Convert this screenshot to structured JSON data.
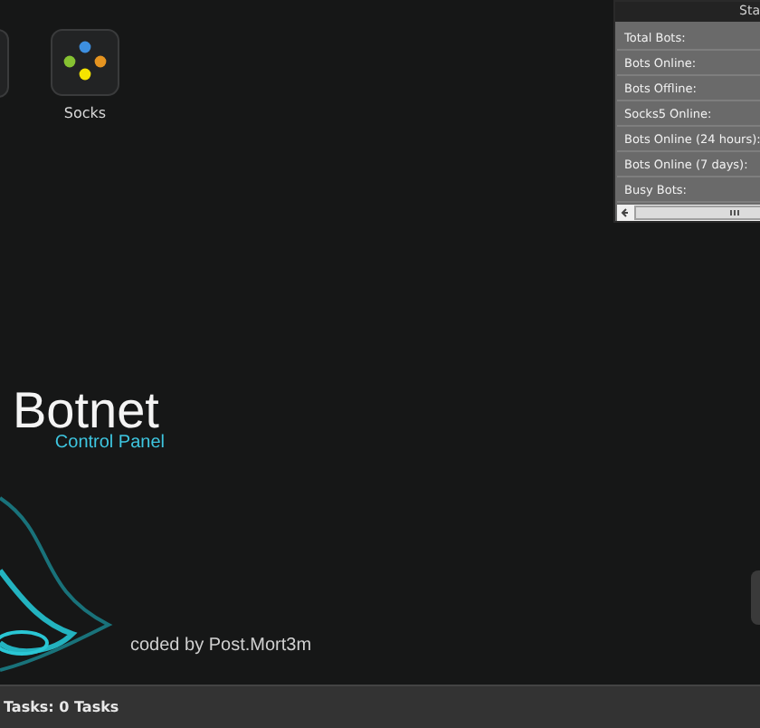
{
  "desktop_icons": [
    {
      "label": "Socks"
    }
  ],
  "stats_panel": {
    "title": "Sta",
    "rows": [
      {
        "label": "Total Bots:"
      },
      {
        "label": "Bots Online:"
      },
      {
        "label": "Bots Offline:"
      },
      {
        "label": "Socks5 Online:"
      },
      {
        "label": "Bots Online (24 hours):"
      },
      {
        "label": "Bots Online (7 days):"
      },
      {
        "label": "Busy Bots:"
      }
    ]
  },
  "logo": {
    "title": "Botnet",
    "subtitle": "Control Panel"
  },
  "credit": "coded by Post.Mort3m",
  "status_bar": {
    "text": "Tasks: 0 Tasks"
  }
}
